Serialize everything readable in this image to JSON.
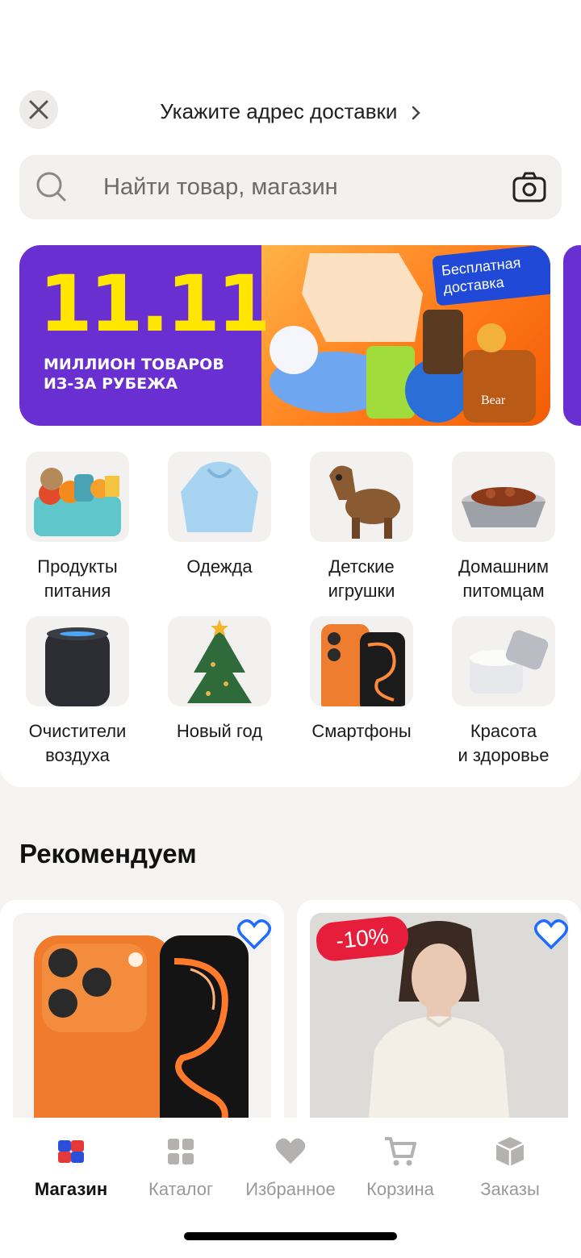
{
  "header": {
    "address_prompt": "Укажите адрес доставки",
    "close_icon": "close-icon"
  },
  "search": {
    "placeholder": "Найти товар, магазин"
  },
  "banner": {
    "headline": "11.11",
    "subtitle_line1": "МИЛЛИОН ТОВАРОВ",
    "subtitle_line2": "ИЗ-ЗА РУБЕЖА",
    "badge_line1": "Бесплатная",
    "badge_line2": "доставка",
    "product_text": "Bear"
  },
  "categories": [
    {
      "line1": "Продукты",
      "line2": "питания"
    },
    {
      "line1": "Одежда",
      "line2": ""
    },
    {
      "line1": "Детские",
      "line2": "игрушки"
    },
    {
      "line1": "Домашним",
      "line2": "питомцам"
    },
    {
      "line1": "Очистители",
      "line2": "воздуха"
    },
    {
      "line1": "Новый год",
      "line2": ""
    },
    {
      "line1": "Смартфоны",
      "line2": ""
    },
    {
      "line1": "Красота",
      "line2": "и здоровье"
    }
  ],
  "recommend": {
    "title": "Рекомендуем",
    "discount": "-10%"
  },
  "tabbar": {
    "tabs": [
      {
        "label": "Магазин",
        "icon": "store-logo-icon",
        "active": true
      },
      {
        "label": "Каталог",
        "icon": "grid-icon",
        "active": false
      },
      {
        "label": "Избранное",
        "icon": "heart-icon",
        "active": false
      },
      {
        "label": "Корзина",
        "icon": "cart-icon",
        "active": false
      },
      {
        "label": "Заказы",
        "icon": "box-icon",
        "active": false
      }
    ]
  },
  "colors": {
    "accent_blue": "#1f6bff",
    "banner_purple": "#6a2fd0",
    "banner_yellow": "#ffe600",
    "sale_red": "#e61e3c"
  }
}
